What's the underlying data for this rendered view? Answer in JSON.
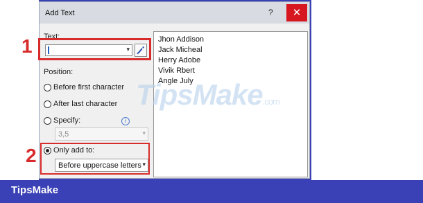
{
  "dialog": {
    "title": "Add Text",
    "help_label": "?",
    "close_label": "✕"
  },
  "text_section": {
    "label": "Text:",
    "input_value": "",
    "dropdown_icon": "chevron-down-icon",
    "picker_icon": "eyedropper-icon"
  },
  "position_section": {
    "label": "Position:",
    "options": [
      {
        "label": "Before first character",
        "selected": false
      },
      {
        "label": "After last character",
        "selected": false
      },
      {
        "label": "Specify:",
        "selected": false
      },
      {
        "label": "Only add to:",
        "selected": true
      }
    ],
    "specify_value": "3,5",
    "only_add_to_value": "Before uppercase letters"
  },
  "list": {
    "items": [
      "Jhon Addison",
      "Jack Micheal",
      "Herry Adobe",
      "Vivik Rbert",
      "Angle July"
    ]
  },
  "annotations": {
    "step1": "1",
    "step2": "2",
    "color": "#d82b2b"
  },
  "watermark": {
    "text": "TipsMake",
    "suffix": ".com"
  },
  "footer": {
    "brand": "TipsMake",
    "background": "#3a40b5"
  }
}
